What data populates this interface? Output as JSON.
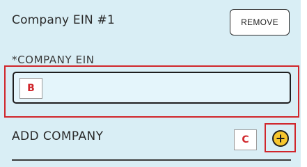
{
  "section": {
    "title": "Company EIN #1",
    "remove_label": "REMOVE"
  },
  "field": {
    "label": "*COMPANY EIN",
    "value": "",
    "placeholder": ""
  },
  "annotations": {
    "b": "B",
    "c": "C"
  },
  "add_company": {
    "label": "ADD COMPANY",
    "icon": "plus-circle-icon"
  },
  "colors": {
    "panel_background": "#d9eef5",
    "input_background": "#e4f5fb",
    "annotation_red": "#d0262b",
    "add_button_yellow": "#f6c62e"
  }
}
